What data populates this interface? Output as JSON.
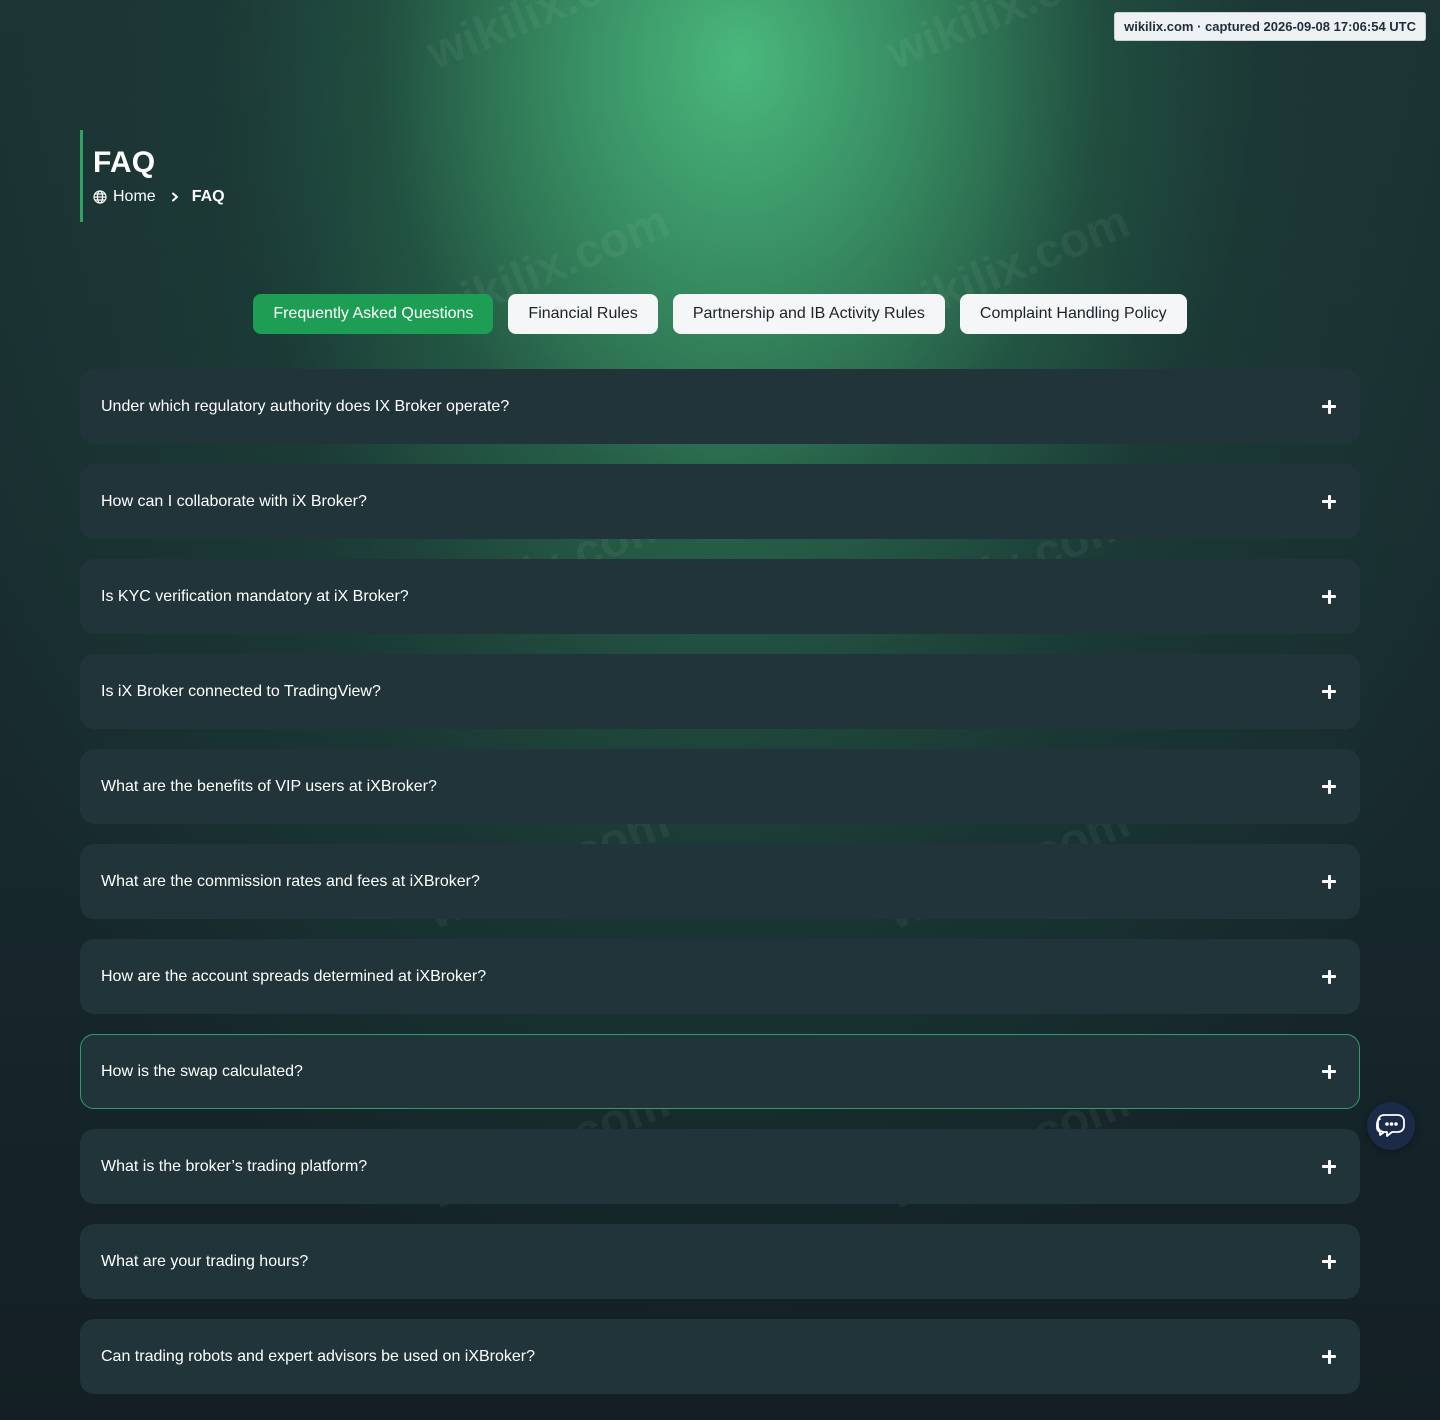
{
  "watermark": {
    "text": "wikilix.com"
  },
  "capture_badge": {
    "text": "wikilix.com · captured 2026-09-08 17:06:54 UTC"
  },
  "header": {
    "title": "FAQ",
    "breadcrumb": {
      "home_label": "Home",
      "current_label": "FAQ",
      "home_icon": "globe-icon",
      "separator_icon": "chevron-right-icon"
    }
  },
  "tabs": [
    {
      "label": "Frequently Asked Questions",
      "active": true
    },
    {
      "label": "Financial Rules",
      "active": false
    },
    {
      "label": "Partnership and IB Activity Rules",
      "active": false
    },
    {
      "label": "Complaint Handling Policy",
      "active": false
    }
  ],
  "faq": [
    {
      "question": "Under which regulatory authority does IX Broker operate?"
    },
    {
      "question": "How can I collaborate with iX Broker?"
    },
    {
      "question": "Is KYC verification mandatory at iX Broker?"
    },
    {
      "question": "Is iX Broker connected to TradingView?"
    },
    {
      "question": "What are the benefits of VIP users at iXBroker?"
    },
    {
      "question": "What are the commission rates and fees at iXBroker?"
    },
    {
      "question": "How are the account spreads determined at iXBroker?"
    },
    {
      "question": "How is the swap calculated?",
      "highlighted": true
    },
    {
      "question": "What is the broker’s trading platform?"
    },
    {
      "question": "What are your trading hours?"
    },
    {
      "question": "Can trading robots and expert advisors be used on iXBroker?"
    }
  ],
  "faq_expand_icon": "plus-icon",
  "chat_widget": {
    "icon": "chat-bubbles-icon"
  },
  "colors": {
    "accent_green": "#1e9e55",
    "card_bg": "#21343a",
    "highlight_border": "#2f9e66",
    "chat_bg": "#1a2a47"
  }
}
